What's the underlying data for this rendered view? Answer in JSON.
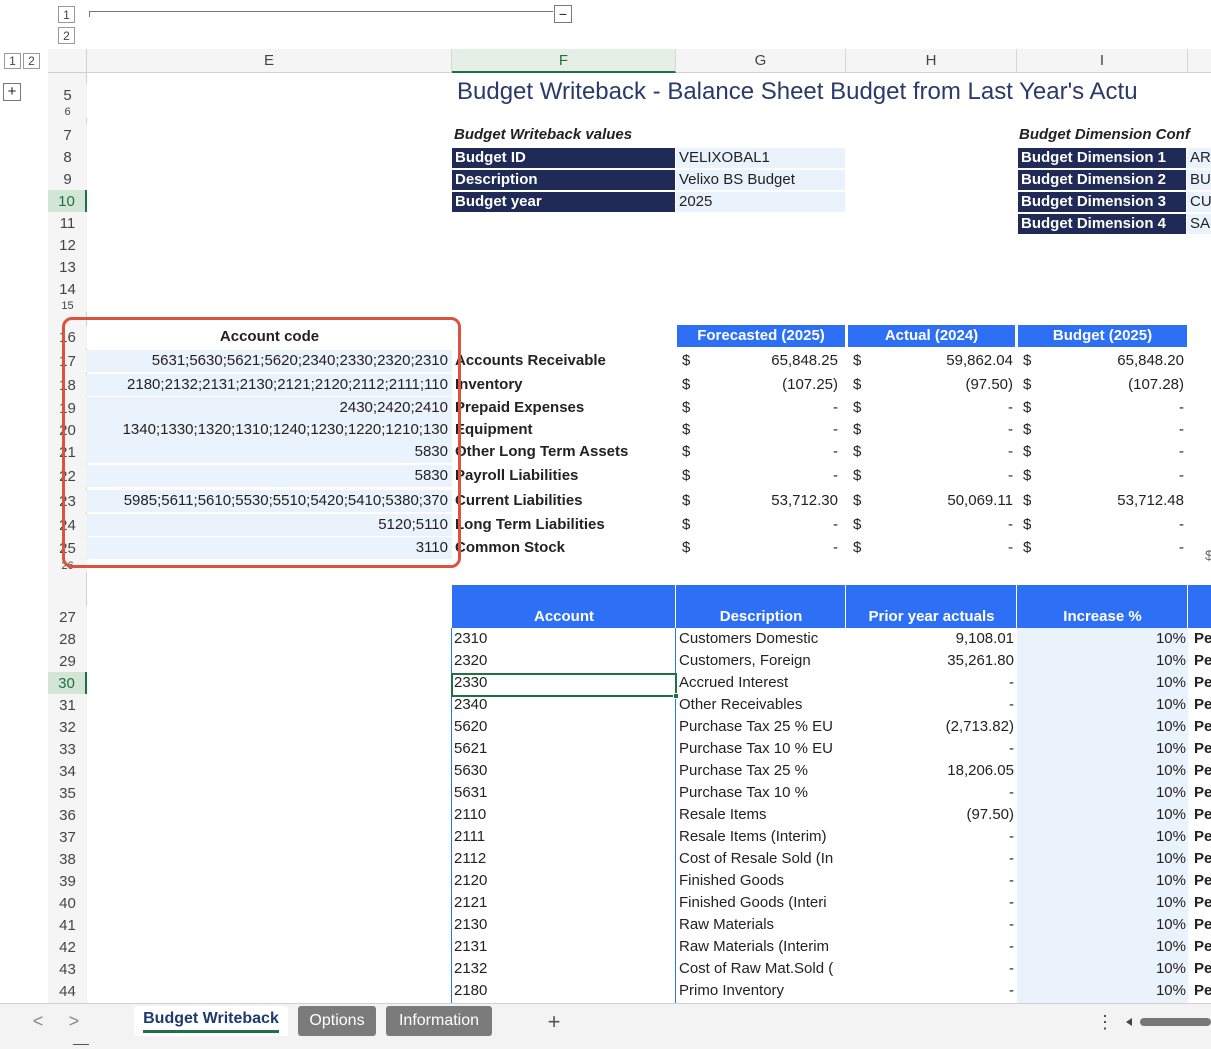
{
  "outline": {
    "levels_top": [
      "1",
      "2"
    ],
    "levels_left": [
      "1",
      "2"
    ],
    "collapse_symbol": "−",
    "expand_symbol": "+"
  },
  "columns": [
    "E",
    "F",
    "G",
    "H",
    "I"
  ],
  "rows": [
    "5",
    "6",
    "7",
    "8",
    "9",
    "10",
    "11",
    "12",
    "13",
    "14",
    "15",
    "16",
    "17",
    "18",
    "19",
    "20",
    "21",
    "22",
    "23",
    "24",
    "25",
    "26",
    "27",
    "28",
    "29",
    "30",
    "31",
    "32",
    "33",
    "34",
    "35",
    "36",
    "37",
    "38",
    "39",
    "40",
    "41",
    "42",
    "43",
    "44"
  ],
  "title": "Budget Writeback - Balance Sheet Budget from Last Year's Actu",
  "writeback": {
    "heading": "Budget Writeback values",
    "items": [
      {
        "label": "Budget ID",
        "value": "VELIXOBAL1"
      },
      {
        "label": "Description",
        "value": "Velixo BS Budget"
      },
      {
        "label": "Budget year",
        "value": "2025"
      }
    ]
  },
  "dimension": {
    "heading": "Budget Dimension Conf",
    "items": [
      {
        "label": "Budget Dimension 1",
        "value": "AR"
      },
      {
        "label": "Budget Dimension 2",
        "value": "BU"
      },
      {
        "label": "Budget Dimension 3",
        "value": "CU"
      },
      {
        "label": "Budget Dimension 4",
        "value": "SA"
      }
    ]
  },
  "summary": {
    "account_code_header": "Account code",
    "headers": [
      "Forecasted (2025)",
      "Actual (2024)",
      "Budget (2025)"
    ],
    "currency": "$",
    "rows": [
      {
        "codes": "2310;2320;2330;2340;5620;5621;5630;5631",
        "name": "Accounts Receivable",
        "forecast": "65,848.25",
        "actual": "59,862.04",
        "budget": "65,848.20"
      },
      {
        "codes": "110;2111;2112;2120;2121;2130;2131;2132;2180",
        "name": "Inventory",
        "forecast": "(107.25)",
        "actual": "(97.50)",
        "budget": "(107.28)"
      },
      {
        "codes": "2410;2420;2430",
        "name": "Prepaid Expenses",
        "forecast": "-",
        "actual": "-",
        "budget": "-"
      },
      {
        "codes": "130;1210;1220;1230;1240;1310;1320;1330;1340",
        "name": "Equipment",
        "forecast": "-",
        "actual": "-",
        "budget": "-"
      },
      {
        "codes": "5830",
        "name": "Other Long Term Assets",
        "forecast": "-",
        "actual": "-",
        "budget": "-"
      },
      {
        "codes": "5830",
        "name": "Payroll Liabilities",
        "forecast": "-",
        "actual": "-",
        "budget": "-"
      },
      {
        "codes": "370;5380;5410;5420;5510;5530;5610;5611;5985",
        "name": "Current Liabilities",
        "forecast": "53,712.30",
        "actual": "50,069.11",
        "budget": "53,712.48"
      },
      {
        "codes": "5110;5120",
        "name": "Long Term Liabilities",
        "forecast": "-",
        "actual": "-",
        "budget": "-"
      },
      {
        "codes": "3110",
        "name": "Common Stock",
        "forecast": "-",
        "actual": "-",
        "budget": "-"
      }
    ],
    "trailing_char": "$"
  },
  "detail": {
    "headers": [
      "Account",
      "Description",
      "Prior year actuals",
      "Increase %"
    ],
    "method_prefix": "Pe",
    "rows": [
      {
        "account": "2310",
        "desc": "Customers Domestic",
        "prior": "9,108.01",
        "inc": "10%"
      },
      {
        "account": "2320",
        "desc": "Customers, Foreign",
        "prior": "35,261.80",
        "inc": "10%"
      },
      {
        "account": "2330",
        "desc": "Accrued Interest",
        "prior": "-",
        "inc": "10%"
      },
      {
        "account": "2340",
        "desc": "Other Receivables",
        "prior": "-",
        "inc": "10%"
      },
      {
        "account": "5620",
        "desc": "Purchase Tax 25 % EU",
        "prior": "(2,713.82)",
        "inc": "10%"
      },
      {
        "account": "5621",
        "desc": "Purchase Tax 10 % EU",
        "prior": "-",
        "inc": "10%"
      },
      {
        "account": "5630",
        "desc": "Purchase Tax 25 %",
        "prior": "18,206.05",
        "inc": "10%"
      },
      {
        "account": "5631",
        "desc": "Purchase Tax 10 %",
        "prior": "-",
        "inc": "10%"
      },
      {
        "account": "2110",
        "desc": "Resale Items",
        "prior": "(97.50)",
        "inc": "10%"
      },
      {
        "account": "2111",
        "desc": "Resale Items (Interim)",
        "prior": "-",
        "inc": "10%"
      },
      {
        "account": "2112",
        "desc": "Cost of Resale Sold (In",
        "prior": "-",
        "inc": "10%"
      },
      {
        "account": "2120",
        "desc": "Finished Goods",
        "prior": "-",
        "inc": "10%"
      },
      {
        "account": "2121",
        "desc": "Finished Goods (Interi",
        "prior": "-",
        "inc": "10%"
      },
      {
        "account": "2130",
        "desc": "Raw Materials",
        "prior": "-",
        "inc": "10%"
      },
      {
        "account": "2131",
        "desc": "Raw Materials (Interim",
        "prior": "-",
        "inc": "10%"
      },
      {
        "account": "2132",
        "desc": "Cost of Raw Mat.Sold (",
        "prior": "-",
        "inc": "10%"
      },
      {
        "account": "2180",
        "desc": "Primo Inventory",
        "prior": "-",
        "inc": "10%"
      }
    ]
  },
  "tabs": [
    "Budget Writeback",
    "Options",
    "Information"
  ],
  "tab_controls": {
    "prev": "<",
    "next": ">",
    "add": "+",
    "more": "⋮"
  },
  "colors": {
    "navy": "#1f2a56",
    "blue": "#2d6ff5",
    "light": "#eaf2fc",
    "highlight": "#d9e8d9",
    "red_outline": "#d9533f"
  }
}
